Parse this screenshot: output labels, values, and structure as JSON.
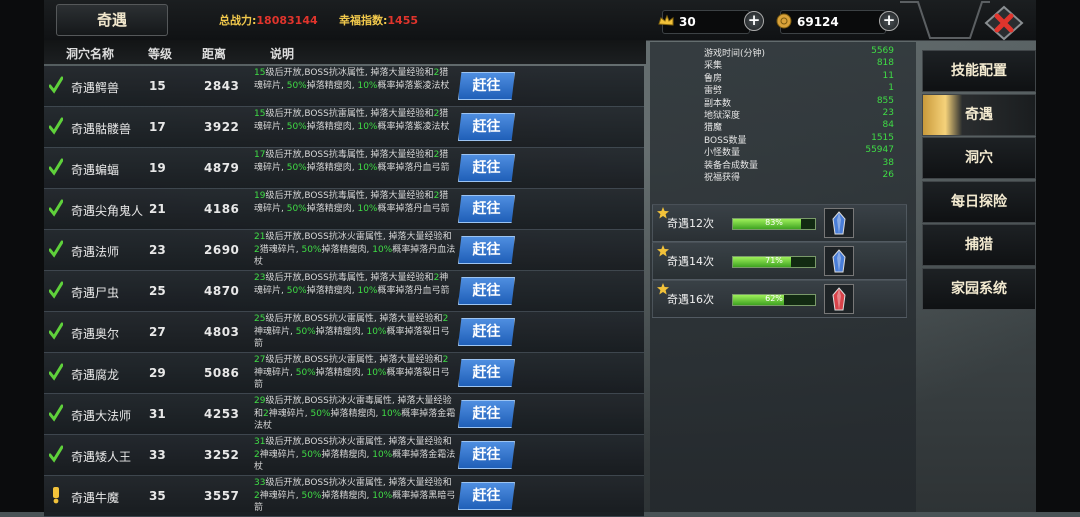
{
  "header": {
    "title": "奇遇",
    "power_label": "总战力:",
    "power_value": "18083144",
    "happy_label": "幸福指数:",
    "happy_value": "1455",
    "gold": "30",
    "coins": "69124",
    "plus": "+"
  },
  "columns": [
    "洞穴名称",
    "等级",
    "距离",
    "说明"
  ],
  "go_label": "赶往",
  "rows": [
    {
      "status": "check",
      "name": "奇遇鳄兽",
      "level": "15",
      "distance": "2843",
      "desc": [
        [
          "15",
          "g"
        ],
        [
          "级后开放,BOSS抗冰属性, 掉落大量经验和",
          ""
        ],
        [
          "2",
          "g"
        ],
        [
          "猎魂碎片, ",
          ""
        ],
        [
          "50%",
          "g"
        ],
        [
          "掉落精瘦肉, ",
          ""
        ],
        [
          "10%",
          "g"
        ],
        [
          "概率掉落紫凌法杖",
          ""
        ]
      ]
    },
    {
      "status": "check",
      "name": "奇遇骷髅兽",
      "level": "17",
      "distance": "3922",
      "desc": [
        [
          "15",
          "g"
        ],
        [
          "级后开放,BOSS抗雷属性, 掉落大量经验和",
          ""
        ],
        [
          "2",
          "g"
        ],
        [
          "猎魂碎片, ",
          ""
        ],
        [
          "50%",
          "g"
        ],
        [
          "掉落精瘦肉, ",
          ""
        ],
        [
          "10%",
          "g"
        ],
        [
          "概率掉落紫凌法杖",
          ""
        ]
      ]
    },
    {
      "status": "check",
      "name": "奇遇蝙蝠",
      "level": "19",
      "distance": "4879",
      "desc": [
        [
          "17",
          "g"
        ],
        [
          "级后开放,BOSS抗毒属性, 掉落大量经验和",
          ""
        ],
        [
          "2",
          "g"
        ],
        [
          "猎魂碎片, ",
          ""
        ],
        [
          "50%",
          "g"
        ],
        [
          "掉落精瘦肉, ",
          ""
        ],
        [
          "10%",
          "g"
        ],
        [
          "概率掉落丹血弓箭",
          ""
        ]
      ]
    },
    {
      "status": "check",
      "name": "奇遇尖角鬼人",
      "level": "21",
      "distance": "4186",
      "desc": [
        [
          "19",
          "g"
        ],
        [
          "级后开放,BOSS抗毒属性, 掉落大量经验和",
          ""
        ],
        [
          "2",
          "g"
        ],
        [
          "猎魂碎片, ",
          ""
        ],
        [
          "50%",
          "g"
        ],
        [
          "掉落精瘦肉, ",
          ""
        ],
        [
          "10%",
          "g"
        ],
        [
          "概率掉落丹血弓箭",
          ""
        ]
      ]
    },
    {
      "status": "check",
      "name": "奇遇法师",
      "level": "23",
      "distance": "2690",
      "desc": [
        [
          "21",
          "g"
        ],
        [
          "级后开放,BOSS抗冰火雷属性, 掉落大量经验和",
          ""
        ],
        [
          "2",
          "g"
        ],
        [
          "猎魂碎片, ",
          ""
        ],
        [
          "50%",
          "g"
        ],
        [
          "掉落精瘦肉, ",
          ""
        ],
        [
          "10%",
          "g"
        ],
        [
          "概率掉落丹血法杖",
          ""
        ]
      ]
    },
    {
      "status": "check",
      "name": "奇遇尸虫",
      "level": "25",
      "distance": "4870",
      "desc": [
        [
          "23",
          "g"
        ],
        [
          "级后开放,BOSS抗毒属性, 掉落大量经验和",
          ""
        ],
        [
          "2",
          "g"
        ],
        [
          "神魂碎片, ",
          ""
        ],
        [
          "50%",
          "g"
        ],
        [
          "掉落精瘦肉, ",
          ""
        ],
        [
          "10%",
          "g"
        ],
        [
          "概率掉落丹血弓箭",
          ""
        ]
      ]
    },
    {
      "status": "check",
      "name": "奇遇奥尔",
      "level": "27",
      "distance": "4803",
      "desc": [
        [
          "25",
          "g"
        ],
        [
          "级后开放,BOSS抗火雷属性, 掉落大量经验和",
          ""
        ],
        [
          "2",
          "g"
        ],
        [
          "神魂碎片, ",
          ""
        ],
        [
          "50%",
          "g"
        ],
        [
          "掉落精瘦肉, ",
          ""
        ],
        [
          "10%",
          "g"
        ],
        [
          "概率掉落裂日弓箭",
          ""
        ]
      ]
    },
    {
      "status": "check",
      "name": "奇遇腐龙",
      "level": "29",
      "distance": "5086",
      "desc": [
        [
          "27",
          "g"
        ],
        [
          "级后开放,BOSS抗火雷属性, 掉落大量经验和",
          ""
        ],
        [
          "2",
          "g"
        ],
        [
          "神魂碎片, ",
          ""
        ],
        [
          "50%",
          "g"
        ],
        [
          "掉落精瘦肉, ",
          ""
        ],
        [
          "10%",
          "g"
        ],
        [
          "概率掉落裂日弓箭",
          ""
        ]
      ]
    },
    {
      "status": "check",
      "name": "奇遇大法师",
      "level": "31",
      "distance": "4253",
      "desc": [
        [
          "29",
          "g"
        ],
        [
          "级后开放,BOSS抗冰火雷毒属性, 掉落大量经验和",
          ""
        ],
        [
          "2",
          "g"
        ],
        [
          "神魂碎片, ",
          ""
        ],
        [
          "50%",
          "g"
        ],
        [
          "掉落精瘦肉, ",
          ""
        ],
        [
          "10%",
          "g"
        ],
        [
          "概率掉落金霜法杖",
          ""
        ]
      ]
    },
    {
      "status": "check",
      "name": "奇遇矮人王",
      "level": "33",
      "distance": "3252",
      "desc": [
        [
          "31",
          "g"
        ],
        [
          "级后开放,BOSS抗冰火雷属性, 掉落大量经验和",
          ""
        ],
        [
          "2",
          "g"
        ],
        [
          "神魂碎片, ",
          ""
        ],
        [
          "50%",
          "g"
        ],
        [
          "掉落精瘦肉, ",
          ""
        ],
        [
          "10%",
          "g"
        ],
        [
          "概率掉落金霜法杖",
          ""
        ]
      ]
    },
    {
      "status": "alert",
      "name": "奇遇牛魔",
      "level": "35",
      "distance": "3557",
      "desc": [
        [
          "33",
          "g"
        ],
        [
          "级后开放,BOSS抗冰火雷属性, 掉落大量经验和",
          ""
        ],
        [
          "2",
          "g"
        ],
        [
          "神魂碎片, ",
          ""
        ],
        [
          "50%",
          "g"
        ],
        [
          "掉落精瘦肉, ",
          ""
        ],
        [
          "10%",
          "g"
        ],
        [
          "概率掉落黑暗弓箭",
          ""
        ]
      ]
    }
  ],
  "stats": [
    {
      "label": "游戏时间(分钟)",
      "value": "5569"
    },
    {
      "label": "采集",
      "value": "818"
    },
    {
      "label": "鲁房",
      "value": "11"
    },
    {
      "label": "雷劈",
      "value": "1"
    },
    {
      "label": "副本数",
      "value": "855"
    },
    {
      "label": "地狱深度",
      "value": "23"
    },
    {
      "label": "猎魔",
      "value": "84"
    },
    {
      "label": "BOSS数量",
      "value": "1515"
    },
    {
      "label": "小怪数量",
      "value": "55947"
    },
    {
      "label": "装备合成数量",
      "value": "38"
    },
    {
      "label": "祝福获得",
      "value": "26"
    }
  ],
  "progress": [
    {
      "label": "奇遇12次",
      "percent": 83,
      "text": "83%",
      "gem": "blue-crystal-icon",
      "color": "#4a7ed8"
    },
    {
      "label": "奇遇14次",
      "percent": 71,
      "text": "71%",
      "gem": "blue-crystal-icon",
      "color": "#4a7ed8"
    },
    {
      "label": "奇遇16次",
      "percent": 62,
      "text": "62%",
      "gem": "red-crystal-icon",
      "color": "#d8434a"
    }
  ],
  "menu": [
    {
      "label": "技能配置",
      "active": false
    },
    {
      "label": "奇遇",
      "active": true
    },
    {
      "label": "洞穴",
      "active": false
    },
    {
      "label": "每日探险",
      "active": false
    },
    {
      "label": "捕猎",
      "active": false
    },
    {
      "label": "家园系统",
      "active": false
    }
  ]
}
